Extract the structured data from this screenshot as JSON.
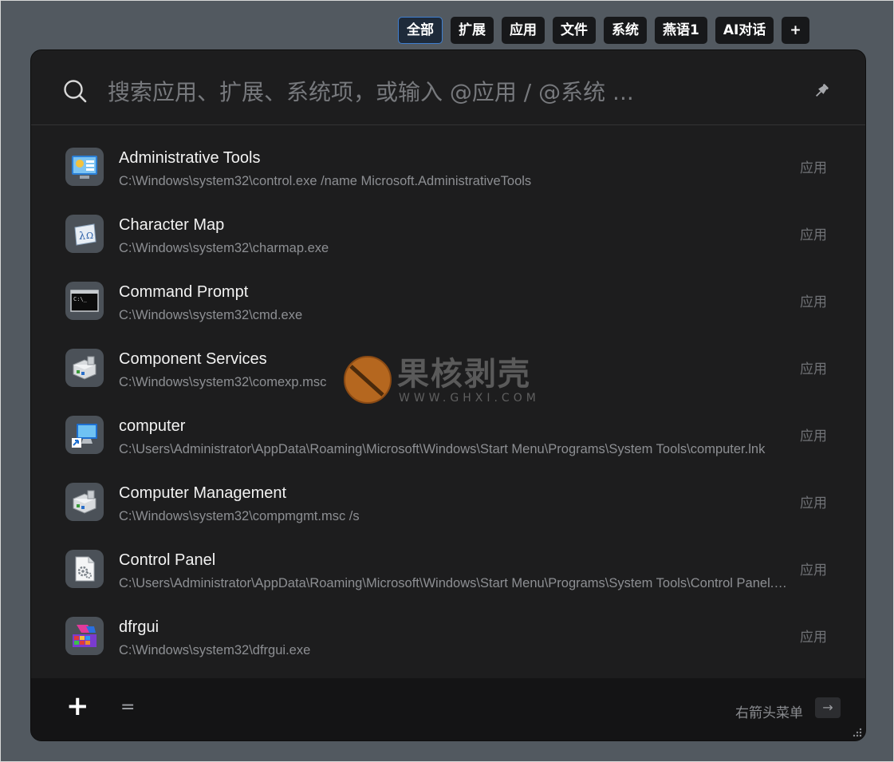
{
  "tabs": [
    {
      "label": "全部",
      "active": true
    },
    {
      "label": "扩展",
      "active": false
    },
    {
      "label": "应用",
      "active": false
    },
    {
      "label": "文件",
      "active": false
    },
    {
      "label": "系统",
      "active": false
    },
    {
      "label": "燕语1",
      "active": false
    },
    {
      "label": "AI对话",
      "active": false
    },
    {
      "label": "+",
      "active": false
    }
  ],
  "search": {
    "placeholder": "搜索应用、扩展、系统项，或输入 @应用 / @系统 ...",
    "value": "",
    "icon": "search-icon",
    "pin_icon": "pin-icon"
  },
  "results": [
    {
      "title": "Administrative Tools",
      "path": "C:\\Windows\\system32\\control.exe /name Microsoft.AdministrativeTools",
      "type": "应用",
      "icon": "admin-tools-icon"
    },
    {
      "title": "Character Map",
      "path": "C:\\Windows\\system32\\charmap.exe",
      "type": "应用",
      "icon": "charmap-icon"
    },
    {
      "title": "Command Prompt",
      "path": "C:\\Windows\\system32\\cmd.exe",
      "type": "应用",
      "icon": "cmd-icon"
    },
    {
      "title": "Component Services",
      "path": "C:\\Windows\\system32\\comexp.msc",
      "type": "应用",
      "icon": "component-services-icon"
    },
    {
      "title": "computer",
      "path": "C:\\Users\\Administrator\\AppData\\Roaming\\Microsoft\\Windows\\Start Menu\\Programs\\System Tools\\computer.lnk",
      "type": "应用",
      "icon": "computer-icon"
    },
    {
      "title": "Computer Management",
      "path": "C:\\Windows\\system32\\compmgmt.msc /s",
      "type": "应用",
      "icon": "computer-management-icon"
    },
    {
      "title": "Control Panel",
      "path": "C:\\Users\\Administrator\\AppData\\Roaming\\Microsoft\\Windows\\Start Menu\\Programs\\System Tools\\Control Panel.lnk",
      "type": "应用",
      "icon": "control-panel-icon"
    },
    {
      "title": "dfrgui",
      "path": "C:\\Windows\\system32\\dfrgui.exe",
      "type": "应用",
      "icon": "defrag-icon"
    }
  ],
  "watermark": {
    "cn": "果核剥壳",
    "en": "WWW.GHXI.COM"
  },
  "footer": {
    "add_label": "+",
    "menu_label": "=",
    "hint_label": "右箭头菜单",
    "arrow_key": "→"
  },
  "colors": {
    "accent": "#3f7fd0",
    "panel_bg": "#1d1d1e",
    "page_bg": "#525960"
  }
}
